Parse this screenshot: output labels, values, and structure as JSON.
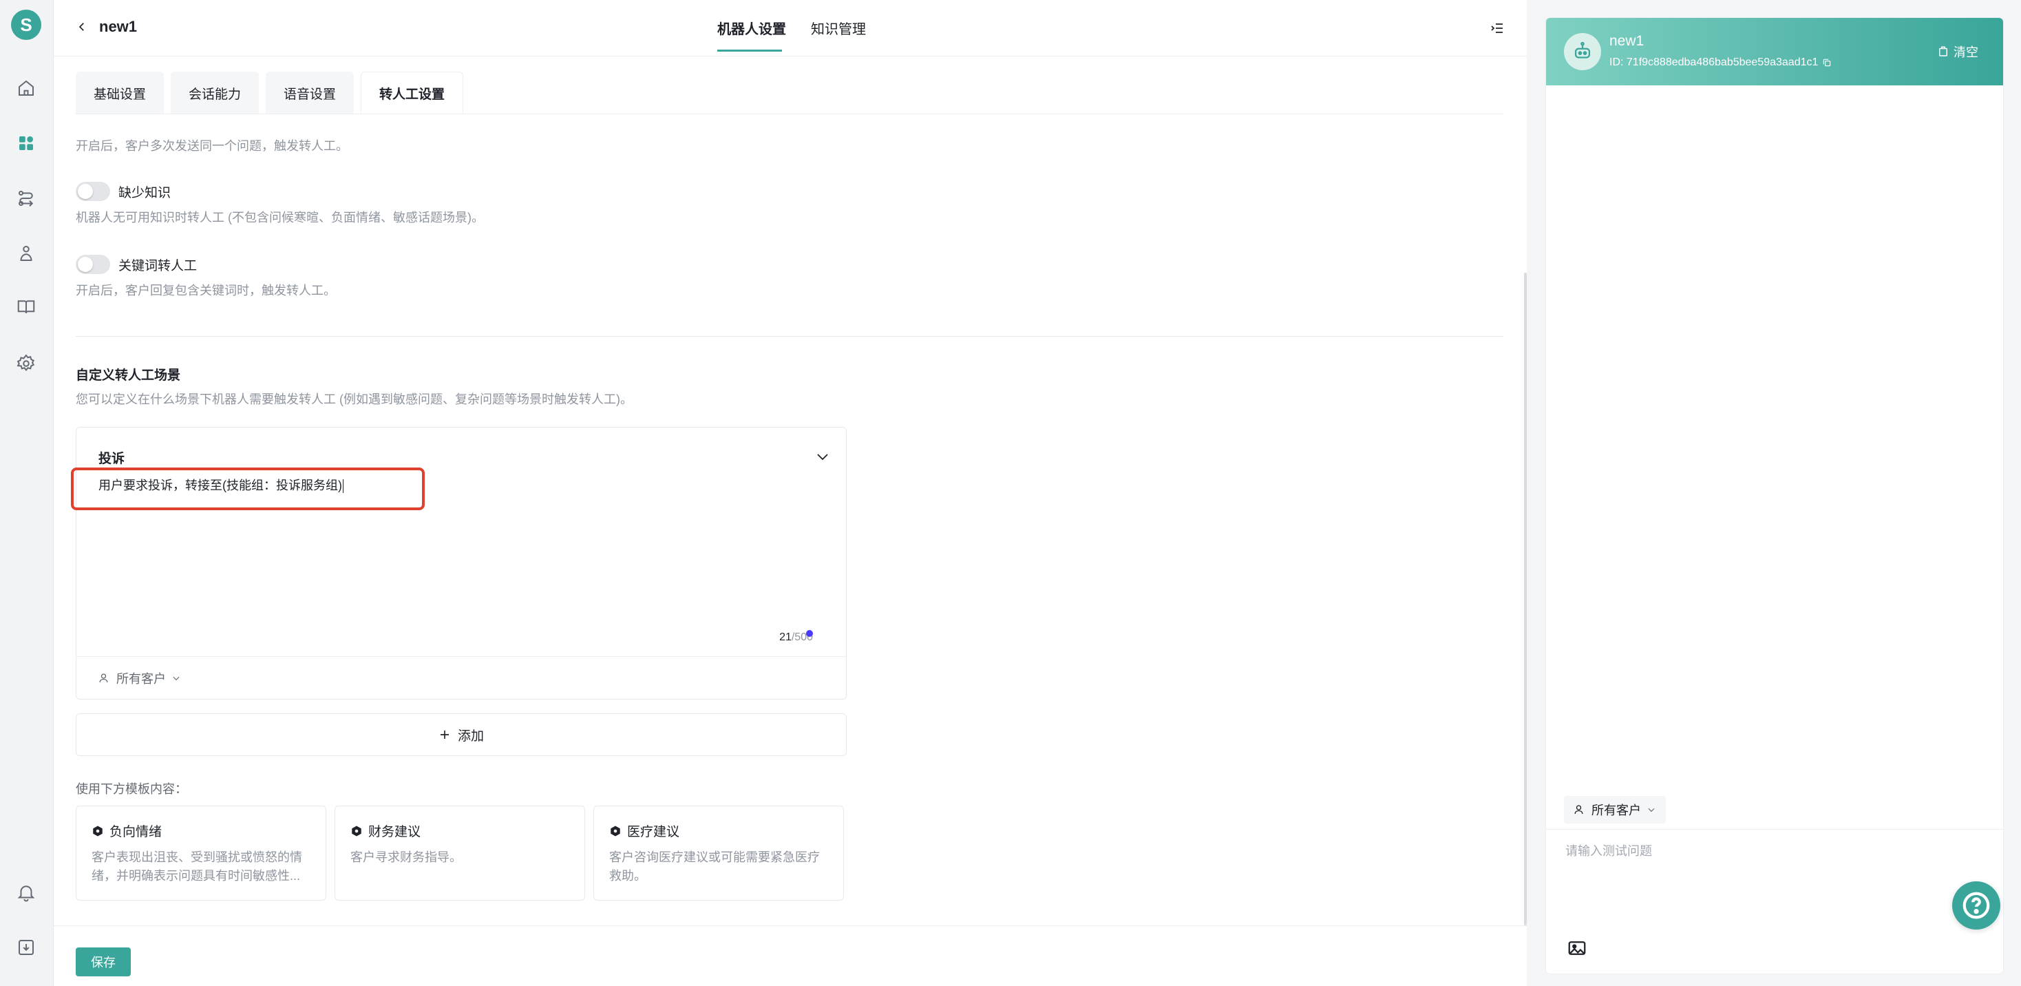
{
  "app": {
    "logo_letter": "S"
  },
  "header": {
    "title": "new1",
    "tabs": [
      {
        "label": "机器人设置",
        "active": true
      },
      {
        "label": "知识管理",
        "active": false
      }
    ]
  },
  "subtabs": [
    {
      "label": "基础设置",
      "active": false
    },
    {
      "label": "会话能力",
      "active": false
    },
    {
      "label": "语音设置",
      "active": false
    },
    {
      "label": "转人工设置",
      "active": true
    }
  ],
  "settings": {
    "repeat_desc": "开启后，客户多次发送同一个问题，触发转人工。",
    "missing_knowledge": {
      "label": "缺少知识",
      "enabled": false,
      "desc": "机器人无可用知识时转人工 (不包含问候寒暄、负面情绪、敏感话题场景)。"
    },
    "keyword_handoff": {
      "label": "关键词转人工",
      "enabled": false,
      "desc": "开启后，客户回复包含关键词时，触发转人工。"
    }
  },
  "custom": {
    "title": "自定义转人工场景",
    "desc": "您可以定义在什么场景下机器人需要触发转人工 (例如遇到敏感问题、复杂问题等场景时触发转人工)。",
    "scenario": {
      "name": "投诉",
      "text": "用户要求投诉，转接至(技能组：投诉服务组)",
      "count": "21",
      "max": "/500",
      "audience": "所有客户"
    },
    "add_label": "添加",
    "template_label": "使用下方模板内容：",
    "templates": [
      {
        "title": "负向情绪",
        "desc": "客户表现出沮丧、受到骚扰或愤怒的情绪，并明确表示问题具有时间敏感性..."
      },
      {
        "title": "财务建议",
        "desc": "客户寻求财务指导。"
      },
      {
        "title": "医疗建议",
        "desc": "客户咨询医疗建议或可能需要紧急医疗救助。"
      }
    ]
  },
  "footer": {
    "save_label": "保存"
  },
  "chat": {
    "name": "new1",
    "id_text": "ID: 71f9c888edba486bab5bee59a3aad1c1",
    "clear_label": "清空",
    "audience": "所有客户",
    "input_placeholder": "请输入测试问题"
  },
  "colors": {
    "accent": "#3aa59a",
    "highlight": "#e0412f"
  }
}
